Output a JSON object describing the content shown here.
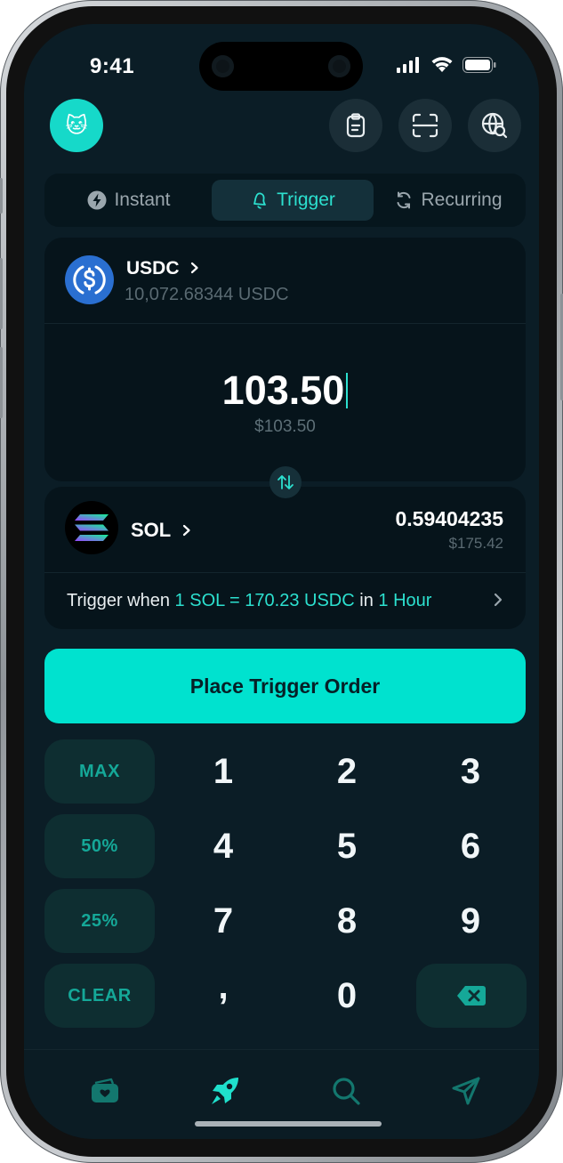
{
  "status_bar": {
    "time": "9:41"
  },
  "header": {
    "avatar_emoji": "🐱",
    "icons": [
      "clipboard-icon",
      "scan-icon",
      "globe-search-icon"
    ]
  },
  "tabs": [
    {
      "label": "Instant",
      "icon": "bolt-icon",
      "active": false
    },
    {
      "label": "Trigger",
      "icon": "bell-icon",
      "active": true
    },
    {
      "label": "Recurring",
      "icon": "refresh-icon",
      "active": false
    }
  ],
  "from": {
    "token": "USDC",
    "balance": "10,072.68344 USDC",
    "amount": "103.50",
    "amount_usd": "$103.50"
  },
  "to": {
    "token": "SOL",
    "amount": "0.59404235",
    "amount_usd": "$175.42"
  },
  "trigger": {
    "prefix": "Trigger when",
    "condition": "1 SOL = 170.23 USDC",
    "middle": "in",
    "duration": "1 Hour"
  },
  "cta_label": "Place Trigger Order",
  "keypad": {
    "quick": [
      "MAX",
      "50%",
      "25%",
      "CLEAR"
    ],
    "digits": [
      "1",
      "2",
      "3",
      "4",
      "5",
      "6",
      "7",
      "8",
      "9",
      ",",
      "0"
    ]
  },
  "bottom_nav": [
    "wallet-icon",
    "rocket-icon",
    "search-icon",
    "send-icon"
  ],
  "colors": {
    "accent": "#00e2cf",
    "background": "#0b1d26",
    "card": "#06141b"
  }
}
